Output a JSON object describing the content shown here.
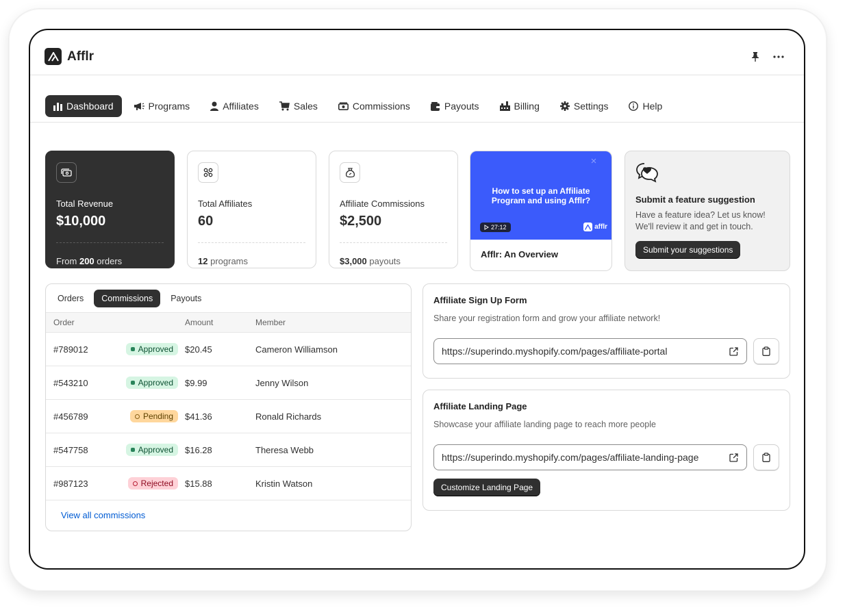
{
  "app": {
    "name": "Afflr"
  },
  "nav": {
    "items": [
      {
        "label": "Dashboard",
        "icon": "bar-chart-icon",
        "active": true
      },
      {
        "label": "Programs",
        "icon": "megaphone-icon"
      },
      {
        "label": "Affiliates",
        "icon": "person-icon"
      },
      {
        "label": "Sales",
        "icon": "cart-icon"
      },
      {
        "label": "Commissions",
        "icon": "cash-icon"
      },
      {
        "label": "Payouts",
        "icon": "wallet-icon"
      },
      {
        "label": "Billing",
        "icon": "billing-icon"
      },
      {
        "label": "Settings",
        "icon": "gear-icon"
      },
      {
        "label": "Help",
        "icon": "info-icon"
      }
    ]
  },
  "stats": {
    "revenue": {
      "label": "Total Revenue",
      "value": "$10,000",
      "foot_prefix": "From",
      "foot_strong": "200",
      "foot_suffix": "orders"
    },
    "affiliates": {
      "label": "Total Affiliates",
      "value": "60",
      "foot_strong": "12",
      "foot_suffix": "programs"
    },
    "commissions": {
      "label": "Affiliate Commissions",
      "value": "$2,500",
      "foot_strong": "$3,000",
      "foot_suffix": "payouts"
    }
  },
  "video": {
    "title": "How to set up an Affiliate Program and using Afflr?",
    "duration": "27:12",
    "brand": "afflr",
    "caption": "Afflr: An Overview"
  },
  "suggestion": {
    "title": "Submit a feature suggestion",
    "text": "Have a feature idea? Let us know! We'll review it and get in touch.",
    "button": "Submit your suggestions"
  },
  "table": {
    "tabs": [
      "Orders",
      "Commissions",
      "Payouts"
    ],
    "active_tab": 1,
    "headers": {
      "order": "Order",
      "amount": "Amount",
      "member": "Member"
    },
    "rows": [
      {
        "order": "#789012",
        "status": "Approved",
        "amount": "$20.45",
        "member": "Cameron Williamson"
      },
      {
        "order": "#543210",
        "status": "Approved",
        "amount": "$9.99",
        "member": "Jenny Wilson"
      },
      {
        "order": "#456789",
        "status": "Pending",
        "amount": "$41.36",
        "member": "Ronald Richards"
      },
      {
        "order": "#547758",
        "status": "Approved",
        "amount": "$16.28",
        "member": "Theresa Webb"
      },
      {
        "order": "#987123",
        "status": "Rejected",
        "amount": "$15.88",
        "member": "Kristin Watson"
      }
    ],
    "view_all": "View all commissions"
  },
  "signup_form": {
    "title": "Affiliate Sign Up Form",
    "desc": "Share your registration form and grow your affiliate network!",
    "url": "https://superindo.myshopify.com/pages/affiliate-portal"
  },
  "landing_page": {
    "title": "Affiliate Landing Page",
    "desc": "Showcase your affiliate landing page to reach more people",
    "url": "https://superindo.myshopify.com/pages/affiliate-landing-page",
    "button": "Customize Landing Page"
  },
  "colors": {
    "dark": "#303030",
    "video_bg": "#3b5bfb",
    "link": "#005bd3"
  }
}
